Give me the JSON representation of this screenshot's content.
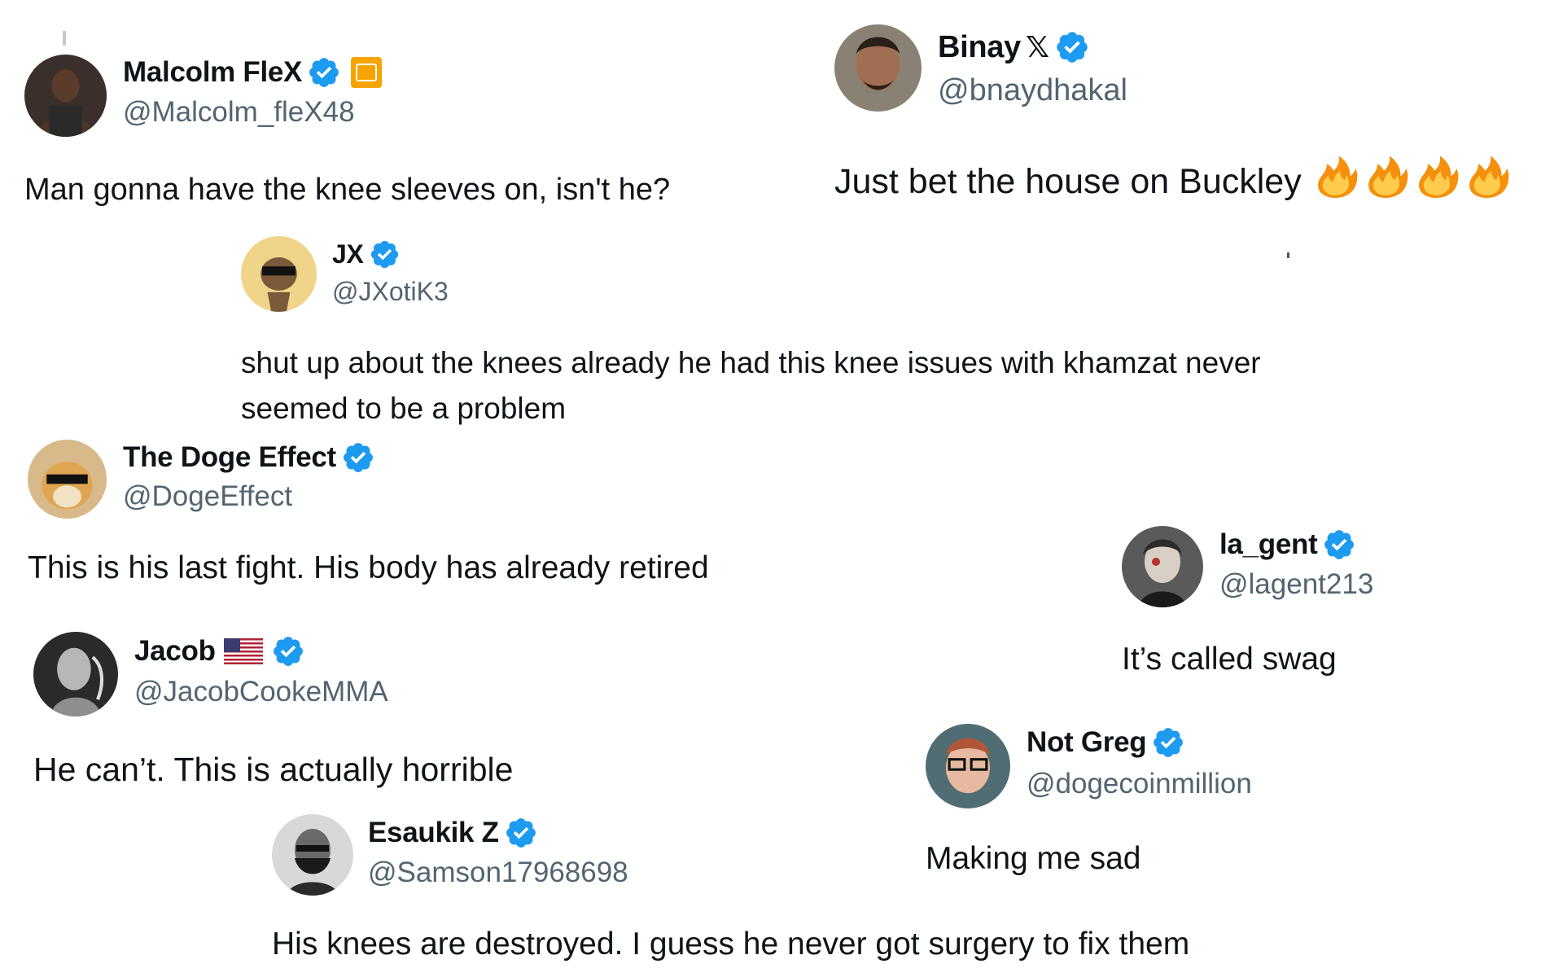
{
  "tweets": [
    {
      "id": "malcolm",
      "name": "Malcolm FleX",
      "handle": "@Malcolm_fleX48",
      "verified": true,
      "affiliate_badge": true,
      "text": "Man gonna have the knee sleeves on, isn't he?"
    },
    {
      "id": "binay",
      "name": "Binay",
      "name_suffix": "𝕏",
      "handle": "@bnaydhakal",
      "verified": true,
      "text": "Just bet the house on Buckley",
      "emoji": [
        "fire",
        "fire",
        "fire",
        "fire"
      ]
    },
    {
      "id": "jx",
      "name": "JX",
      "handle": "@JXotiK3",
      "verified": true,
      "text": "shut up about the knees already he had this knee issues with khamzat never seemed to be a problem"
    },
    {
      "id": "doge",
      "name": "The Doge Effect",
      "handle": "@DogeEffect",
      "verified": true,
      "text": "This is his last fight. His body has already retired"
    },
    {
      "id": "lagent",
      "name": "la_gent",
      "handle": "@lagent213",
      "verified": true,
      "text": "It’s called swag"
    },
    {
      "id": "jacob",
      "name": "Jacob",
      "flag": "us-flag",
      "handle": "@JacobCookeMMA",
      "verified": true,
      "text": "He can’t. This is actually horrible"
    },
    {
      "id": "notgreg",
      "name": "Not Greg",
      "handle": "@dogecoinmillion",
      "verified": true,
      "text": "Making me sad"
    },
    {
      "id": "esaukik",
      "name": "Esaukik Z",
      "handle": "@Samson17968698",
      "verified": true,
      "text": "His knees are destroyed.  I guess he never got surgery to fix them"
    }
  ],
  "colors": {
    "verified_blue": "#1d9bf0",
    "handle_gray": "#536471",
    "text": "#0f1419",
    "affiliate_orange": "#f7a400",
    "fire_orange": "#f4900c",
    "fire_yellow": "#ffcc4d"
  }
}
